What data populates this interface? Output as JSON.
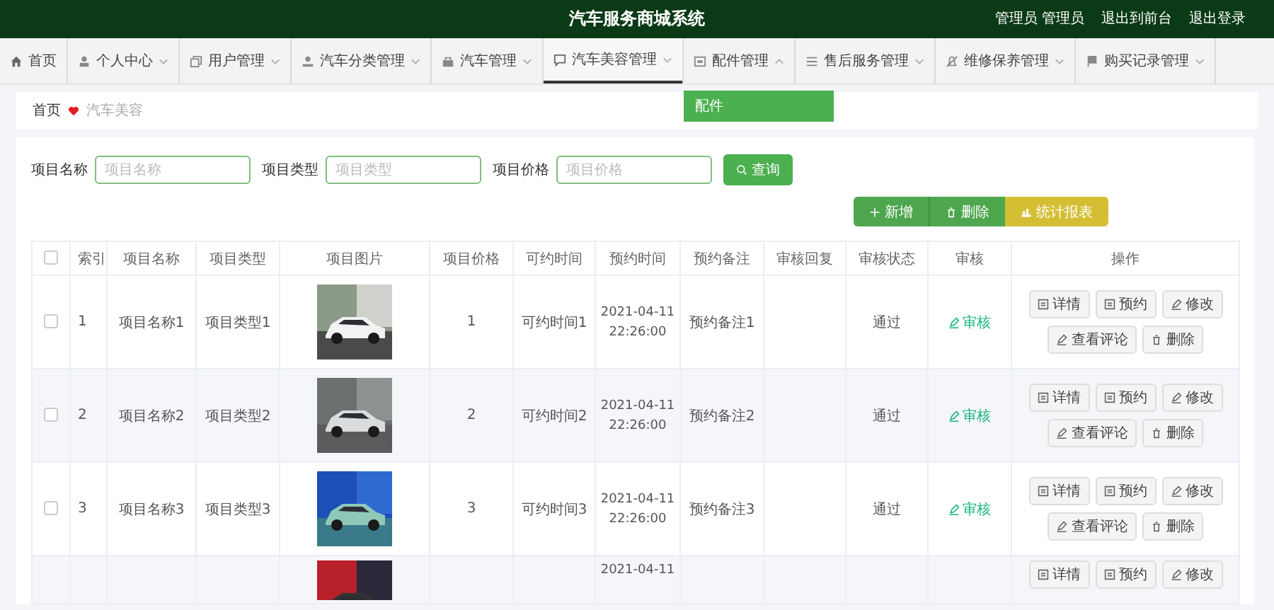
{
  "header": {
    "title": "汽车服务商城系统",
    "links": [
      "管理员 管理员",
      "退出到前台",
      "退出登录"
    ]
  },
  "nav": [
    {
      "label": "首页",
      "selected": false
    },
    {
      "label": "个人中心",
      "expanded": false,
      "selected": false
    },
    {
      "label": "用户管理",
      "expanded": false,
      "selected": false
    },
    {
      "label": "汽车分类管理",
      "expanded": false,
      "selected": false
    },
    {
      "label": "汽车管理",
      "expanded": false,
      "selected": false
    },
    {
      "label": "汽车美容管理",
      "expanded": false,
      "selected": true
    },
    {
      "label": "配件管理",
      "expanded": true,
      "selected": false,
      "menu": [
        "配件"
      ]
    },
    {
      "label": "售后服务管理",
      "expanded": false,
      "selected": false
    },
    {
      "label": "维修保养管理",
      "expanded": false,
      "selected": false
    },
    {
      "label": "购买记录管理",
      "expanded": false,
      "selected": false
    }
  ],
  "breadcrumb": [
    "首页",
    "汽车美容"
  ],
  "search": {
    "fields": [
      {
        "label": "项目名称",
        "placeholder": "项目名称"
      },
      {
        "label": "项目类型",
        "placeholder": "项目类型"
      },
      {
        "label": "项目价格",
        "placeholder": "项目价格"
      }
    ],
    "button": "查询"
  },
  "toolbar": [
    {
      "label": "新增",
      "kind": "add"
    },
    {
      "label": "删除",
      "kind": "delete"
    },
    {
      "label": "统计报表",
      "kind": "report"
    }
  ],
  "table": {
    "header_checked": false,
    "columns": [
      "索引",
      "项目名称",
      "项目类型",
      "项目图片",
      "项目价格",
      "可约时间",
      "预约时间",
      "预约备注",
      "审核回复",
      "审核状态",
      "审核",
      "操作"
    ],
    "rows": [
      {
        "checked": false,
        "index": "1",
        "name": "项目名称1",
        "type": "项目类型1",
        "price": "1",
        "available": "可约时间1",
        "date": "2021-04-11",
        "clock": "22:26:00",
        "note": "预约备注1",
        "status": "通过",
        "review": "审核",
        "actions": [
          {
            "label": "详情",
            "kind": "detail"
          },
          {
            "label": "预约",
            "kind": "book"
          },
          {
            "label": "修改",
            "kind": "edit"
          },
          {
            "label": "查看评论",
            "kind": "edit"
          },
          {
            "label": "删除",
            "kind": "delete"
          }
        ]
      },
      {
        "checked": false,
        "index": "2",
        "name": "项目名称2",
        "type": "项目类型2",
        "price": "2",
        "available": "可约时间2",
        "date": "2021-04-11",
        "clock": "22:26:00",
        "note": "预约备注2",
        "status": "通过",
        "review": "审核",
        "actions": [
          {
            "label": "详情",
            "kind": "detail"
          },
          {
            "label": "预约",
            "kind": "book"
          },
          {
            "label": "修改",
            "kind": "edit"
          },
          {
            "label": "查看评论",
            "kind": "edit"
          },
          {
            "label": "删除",
            "kind": "delete"
          }
        ]
      },
      {
        "checked": false,
        "index": "3",
        "name": "项目名称3",
        "type": "项目类型3",
        "price": "3",
        "available": "可约时间3",
        "date": "2021-04-11",
        "clock": "22:26:00",
        "note": "预约备注3",
        "status": "通过",
        "review": "审核",
        "actions": [
          {
            "label": "详情",
            "kind": "detail"
          },
          {
            "label": "预约",
            "kind": "book"
          },
          {
            "label": "修改",
            "kind": "edit"
          },
          {
            "label": "查看评论",
            "kind": "edit"
          },
          {
            "label": "删除",
            "kind": "delete"
          }
        ]
      },
      {
        "date": "2021-04-11",
        "actions": [
          {
            "label": "详情",
            "kind": "detail"
          },
          {
            "label": "预约",
            "kind": "book"
          },
          {
            "label": "修改",
            "kind": "edit"
          }
        ]
      }
    ]
  }
}
